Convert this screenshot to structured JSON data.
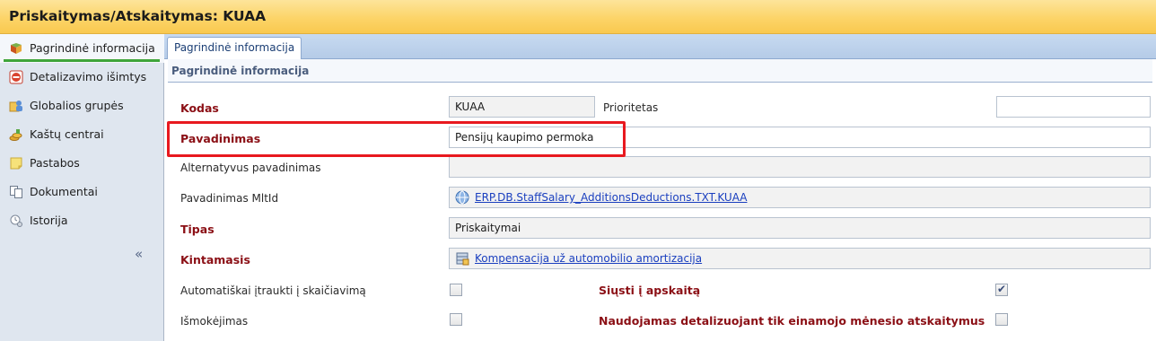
{
  "window": {
    "title": "Priskaitymas/Atskaitymas: KUAA"
  },
  "sidebar": {
    "items": [
      {
        "label": "Pagrindinė informacija",
        "icon": "book-icon",
        "active": true
      },
      {
        "label": "Detalizavimo išimtys",
        "icon": "no-entry-icon"
      },
      {
        "label": "Globalios grupės",
        "icon": "group-icon"
      },
      {
        "label": "Kaštų centrai",
        "icon": "coins-icon"
      },
      {
        "label": "Pastabos",
        "icon": "note-icon"
      },
      {
        "label": "Dokumentai",
        "icon": "documents-icon"
      },
      {
        "label": "Istorija",
        "icon": "history-icon"
      }
    ],
    "collapse_label": "«"
  },
  "tabs": [
    {
      "label": "Pagrindinė informacija",
      "active": true
    }
  ],
  "section": {
    "title": "Pagrindinė informacija"
  },
  "form": {
    "kodas": {
      "label": "Kodas",
      "value": "KUAA"
    },
    "prioritetas": {
      "label": "Prioritetas",
      "value": ""
    },
    "pavadinimas": {
      "label": "Pavadinimas",
      "value": "Pensijų kaupimo permoka"
    },
    "alternatyvus": {
      "label": "Alternatyvus pavadinimas",
      "value": ""
    },
    "mltid": {
      "label": "Pavadinimas MltId",
      "value": "ERP.DB.StaffSalary_AdditionsDeductions.TXT.KUAA"
    },
    "tipas": {
      "label": "Tipas",
      "value": "Priskaitymai"
    },
    "kintamasis": {
      "label": "Kintamasis",
      "value": "Kompensacija už automobilio amortizacija"
    },
    "auto": {
      "label": "Automatiškai įtraukti į skaičiavimą",
      "checked": false
    },
    "siusti": {
      "label": "Siųsti į apskaitą",
      "checked": true
    },
    "ismokejimas": {
      "label": "Išmokėjimas",
      "checked": false
    },
    "naudojamas": {
      "label": "Naudojamas detalizuojant tik einamojo mėnesio atskaitymus",
      "checked": false
    }
  },
  "colors": {
    "required_label": "#8b0f15",
    "link": "#1a3fbf",
    "highlight": "#e8191f",
    "accent_bar": "#3fa53a"
  }
}
